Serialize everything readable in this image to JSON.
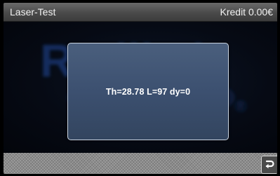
{
  "header": {
    "title": "Laser-Test",
    "credit": "Kredit 0.00€"
  },
  "background": {
    "logo_text": "Radikal",
    "logo_registered": "®"
  },
  "dialog": {
    "message": "Th=28.78 L=97 dy=0"
  },
  "footer": {
    "back_icon": "return-arrow-icon"
  },
  "colors": {
    "titlebar": "#4a4a4a",
    "dialog_bg": "#3c5070",
    "dialog_border": "#c9d3df",
    "logo_blue": "#1f4a9a"
  }
}
